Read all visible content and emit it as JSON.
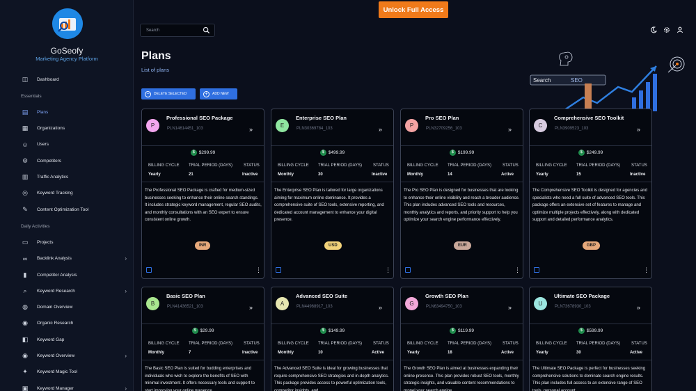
{
  "brand": {
    "name": "GoSeofy",
    "tagline": "Marketing Agency Platform"
  },
  "sidebar": {
    "items": [
      {
        "label": "Dashboard",
        "icon": "dashboard-icon"
      },
      {
        "section": "Essentials"
      },
      {
        "label": "Plans",
        "icon": "plans-icon",
        "active": true
      },
      {
        "label": "Organizations",
        "icon": "building-icon"
      },
      {
        "label": "Users",
        "icon": "users-icon"
      },
      {
        "label": "Competitors",
        "icon": "competitors-icon"
      },
      {
        "label": "Traffic Analytics",
        "icon": "traffic-icon"
      },
      {
        "label": "Keyword Tracking",
        "icon": "tracking-icon"
      },
      {
        "label": "Content Optimization Tool",
        "icon": "tool-icon"
      },
      {
        "section": "Daily Activities"
      },
      {
        "label": "Projects",
        "icon": "folder-icon"
      },
      {
        "label": "Backlink Analysis",
        "icon": "link-icon",
        "expandable": true
      },
      {
        "label": "Competitor Analysis",
        "icon": "bar-chart-icon"
      },
      {
        "label": "Keyword Research",
        "icon": "search-icon",
        "expandable": true
      },
      {
        "label": "Domain Overview",
        "icon": "globe-icon"
      },
      {
        "label": "Organic Research",
        "icon": "organic-icon"
      },
      {
        "label": "Keyword Gap",
        "icon": "gap-icon"
      },
      {
        "label": "Keyword Overview",
        "icon": "eye-icon",
        "expandable": true
      },
      {
        "label": "Keyword Magic Tool",
        "icon": "magic-icon"
      },
      {
        "label": "Keyword Manager",
        "icon": "manager-icon",
        "expandable": true
      }
    ]
  },
  "topbar": {
    "search_placeholder": "Search",
    "unlock_label": "Unlock Full Access"
  },
  "page": {
    "title": "Plans",
    "subtitle": "List of plans",
    "delete_label": "DELETE SELECTED",
    "add_label": "ADD NEW",
    "illustration_search": "Search",
    "illustration_seo": "SEO"
  },
  "card_labels": {
    "billing": "BILLING CYCLE",
    "trial": "TRIAL PERIOD (DAYS)",
    "status": "STATUS"
  },
  "plans": [
    {
      "initial": "P",
      "avatar_color": "#f3a6ef",
      "name": "Professional SEO Package",
      "code": "PLN14614451_103",
      "price": "$299.99",
      "billing": "Yearly",
      "trial": "21",
      "status": "Inactive",
      "currency": "INR",
      "currency_color": "#e6a87b",
      "description": "The Professional SEO Package is crafted for medium-sized businesses seeking to enhance their online search standings. It includes strategic keyword management, regular SEO audits, and monthly consultations with an SEO expert to ensure consistent online growth."
    },
    {
      "initial": "E",
      "avatar_color": "#8fe6a0",
      "name": "Enterprise SEO Plan",
      "code": "PLN30369784_103",
      "price": "$499.99",
      "billing": "Monthly",
      "trial": "30",
      "status": "Inactive",
      "currency": "USD",
      "currency_color": "#f2d27a",
      "description": "The Enterprise SEO Plan is tailored for large organizations aiming for maximum online dominance. It provides a comprehensive suite of SEO tools, extensive reporting, and dedicated account management to enhance your digital presence."
    },
    {
      "initial": "P",
      "avatar_color": "#f4a3a3",
      "name": "Pro SEO Plan",
      "code": "PLN32709256_103",
      "price": "$199.99",
      "billing": "Monthly",
      "trial": "14",
      "status": "Active",
      "currency": "EUR",
      "currency_color": "#c9a89a",
      "description": "The Pro SEO Plan is designed for businesses that are looking to enhance their online visibility and reach a broader audience. This plan includes advanced SEO tools and resources, monthly analytics and reports, and priority support to help you optimize your search engine performance effectively."
    },
    {
      "initial": "C",
      "avatar_color": "#d8cce0",
      "name": "Comprehensive SEO Toolkit",
      "code": "PLN3909523_103",
      "price": "$249.99",
      "billing": "Yearly",
      "trial": "15",
      "status": "Inactive",
      "currency": "GBP",
      "currency_color": "#e6a87b",
      "description": "The Comprehensive SEO Toolkit is designed for agencies and specialists who need a full suite of advanced SEO tools. This package offers an extensive set of features to manage and optimize multiple projects effectively, along with dedicated support and detailed performance analytics."
    },
    {
      "initial": "B",
      "avatar_color": "#a9e68f",
      "name": "Basic SEO Plan",
      "code": "PLN41436521_103",
      "price": "$29.99",
      "billing": "Monthly",
      "trial": "7",
      "status": "Inactive",
      "currency": "",
      "currency_color": "#e6a87b",
      "description": "The Basic SEO Plan is suited for budding enterprises and individuals who wish to explore the benefits of SEO with minimal investment. It offers necessary tools and support to start improving your online presence."
    },
    {
      "initial": "A",
      "avatar_color": "#e6e6b0",
      "name": "Advanced SEO Suite",
      "code": "PLN44968917_103",
      "price": "$149.99",
      "billing": "Monthly",
      "trial": "10",
      "status": "Active",
      "currency": "",
      "currency_color": "#e6a87b",
      "description": "The Advanced SEO Suite is ideal for growing businesses that require comprehensive SEO strategies and in-depth analytics. This package provides access to powerful optimization tools, competitor insights, and"
    },
    {
      "initial": "G",
      "avatar_color": "#f2a8d8",
      "name": "Growth SEO Plan",
      "code": "PLN63494750_103",
      "price": "$119.99",
      "billing": "Yearly",
      "trial": "18",
      "status": "Active",
      "currency": "",
      "currency_color": "#e6a87b",
      "description": "The Growth SEO Plan is aimed at businesses expanding their online presence. This plan provides robust SEO tools, monthly strategic insights, and valuable content recommendations to propel your search engine"
    },
    {
      "initial": "U",
      "avatar_color": "#9ce6e0",
      "name": "Ultimate SEO Package",
      "code": "PLN73678930_103",
      "price": "$599.99",
      "billing": "Yearly",
      "trial": "30",
      "status": "Active",
      "currency": "",
      "currency_color": "#e6a87b",
      "description": "The Ultimate SEO Package is perfect for businesses seeking comprehensive solutions to dominate search engine results. This plan includes full access to an extensive range of SEO tools, personal account"
    }
  ]
}
